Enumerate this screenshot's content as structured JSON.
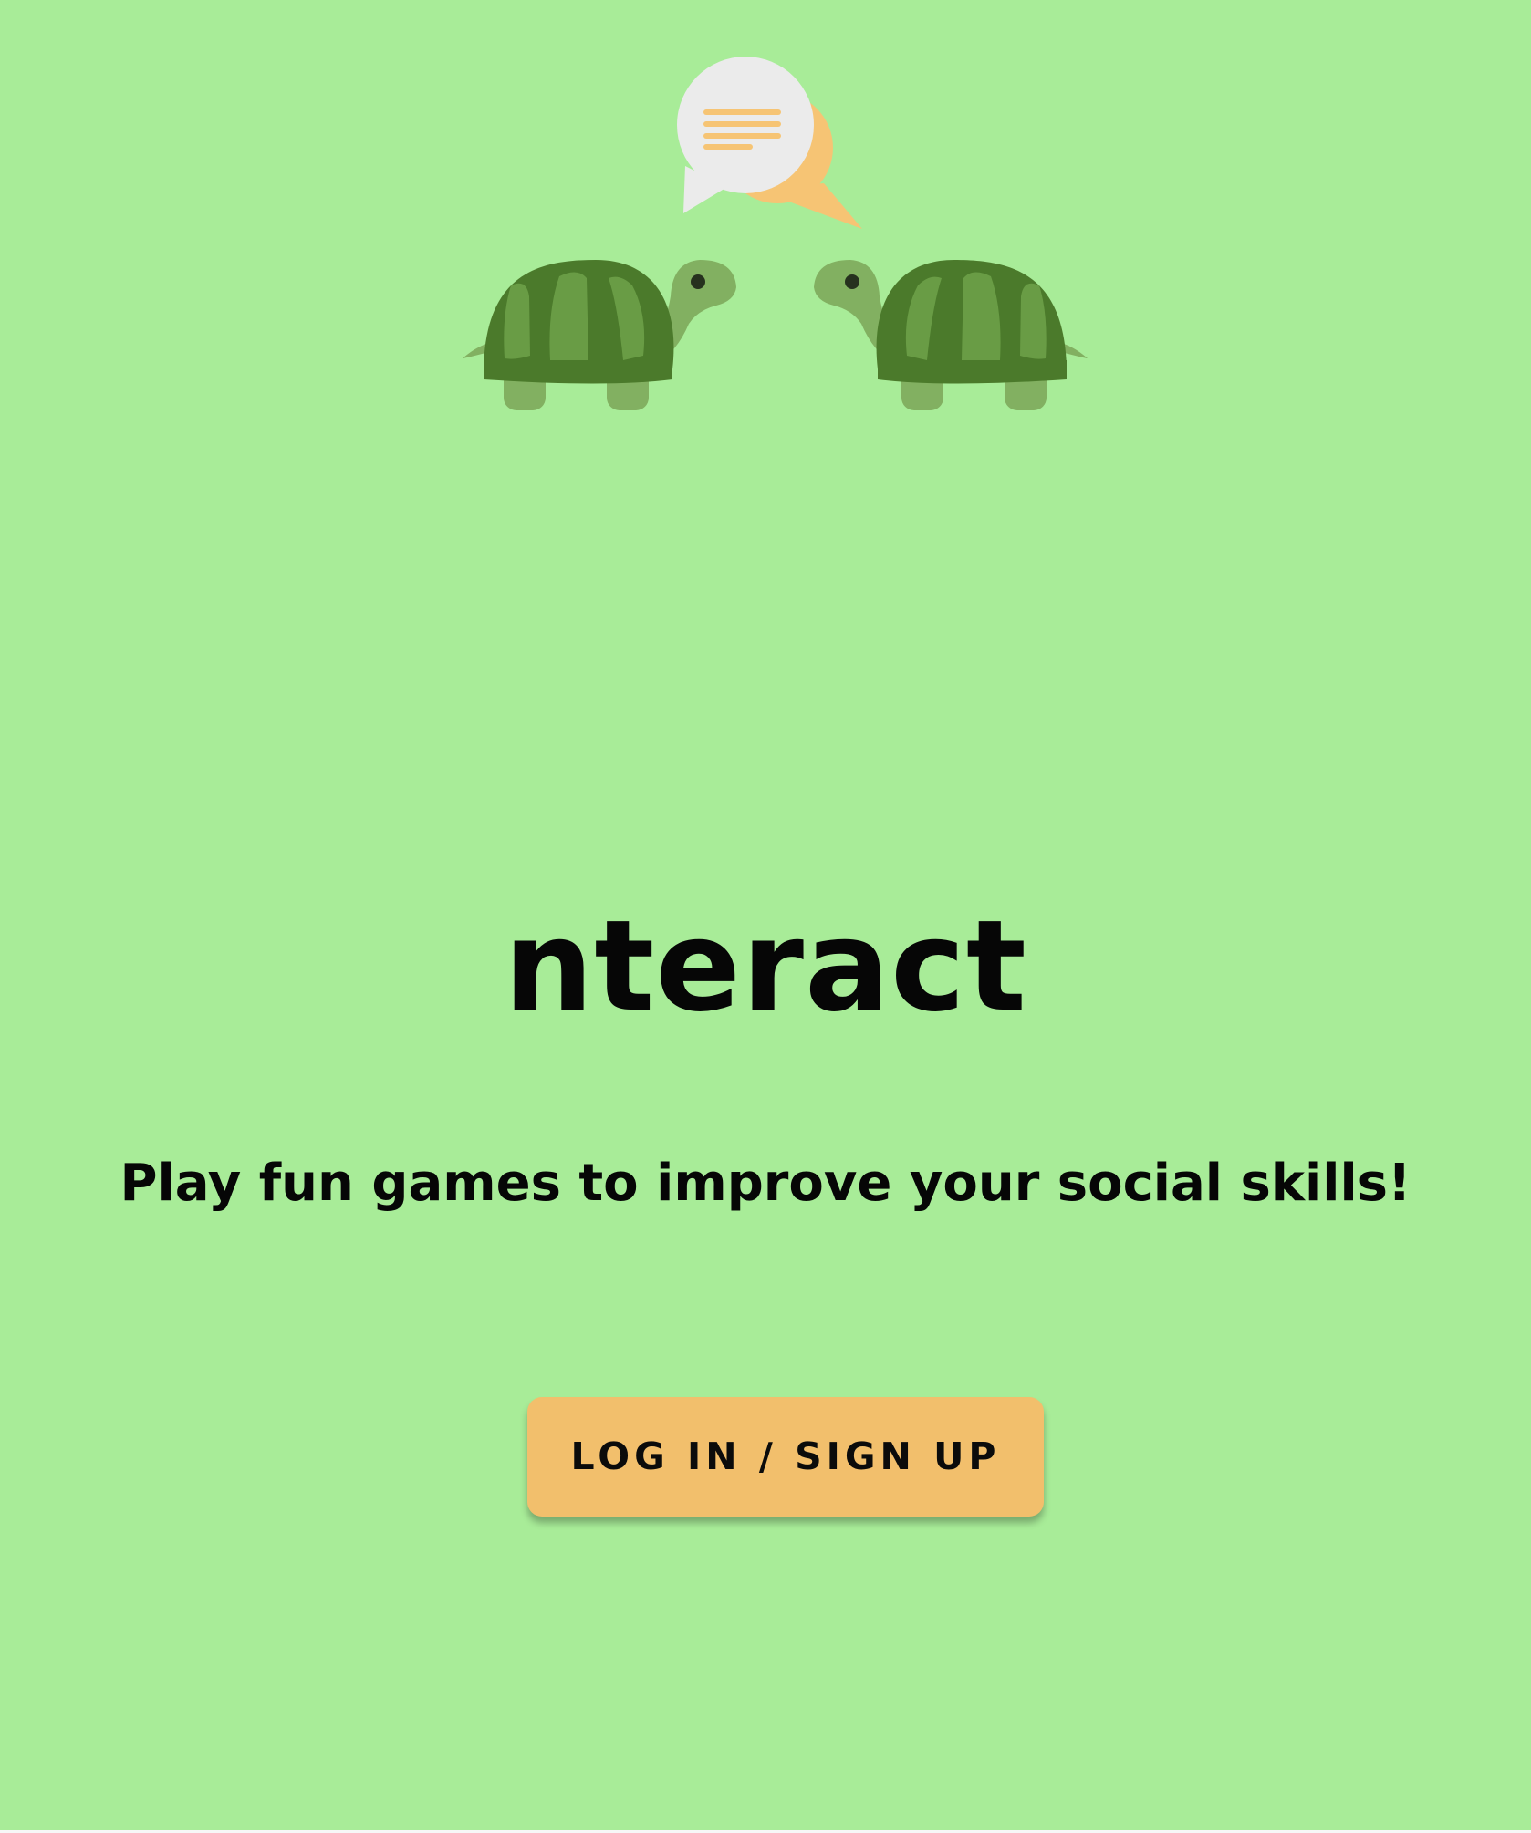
{
  "app": {
    "title": "nteract",
    "tagline": "Play fun games to improve your social skills!"
  },
  "actions": {
    "login_label": "LOG IN / SIGN UP"
  },
  "logo": {
    "icons": [
      "speech-bubbles-icon",
      "turtle-icon",
      "turtle-icon"
    ]
  },
  "colors": {
    "background": "#a8ec98",
    "button": "#f2bf6c",
    "bubble_light": "#ebebeb",
    "bubble_accent": "#f6c474",
    "turtle_shell_dark": "#4b7a2b",
    "turtle_shell_light": "#699c45",
    "turtle_skin": "#82b061",
    "text": "#060606"
  }
}
